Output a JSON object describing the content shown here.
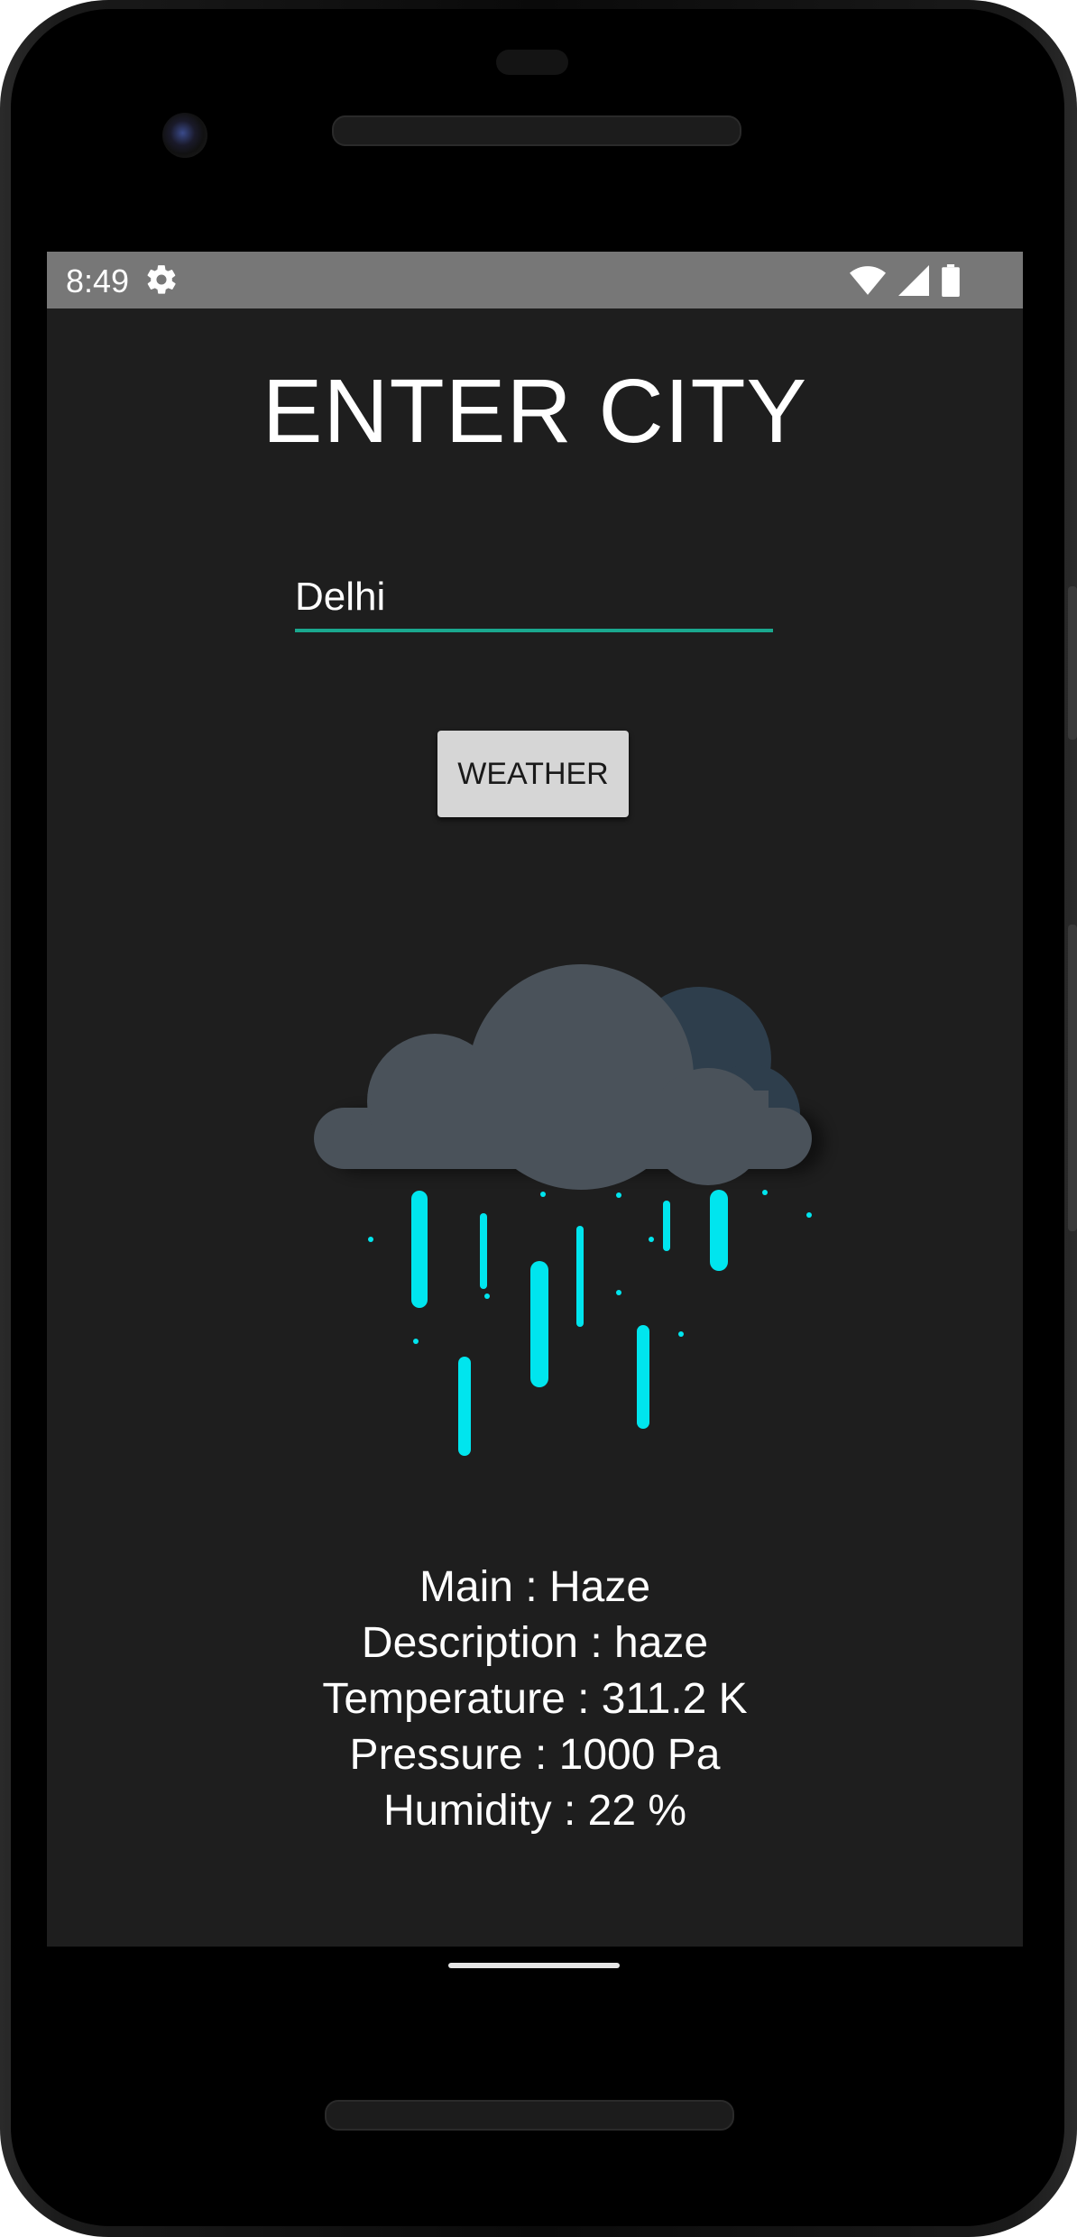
{
  "status_bar": {
    "time": "8:49",
    "icons": [
      "gear-icon",
      "wifi-icon",
      "cell-signal-icon",
      "battery-icon"
    ]
  },
  "app": {
    "title": "ENTER CITY",
    "city_input": {
      "value": "Delhi",
      "placeholder": ""
    },
    "weather_button_label": "WEATHER",
    "illustration": "rain-cloud-icon",
    "details": {
      "main": "Main : Haze",
      "description": "Description : haze",
      "temperature": "Temperature : 311.2 K",
      "pressure": "Pressure : 1000 Pa",
      "humidity": "Humidity : 22 %"
    }
  },
  "colors": {
    "screen_background": "#1e1e1e",
    "status_bar": "#777777",
    "input_underline": "#1aa88f",
    "button_background": "#d6d6d6",
    "rain": "#00e5ee",
    "cloud_front": "#4a525a",
    "cloud_back": "#2e3e4c"
  }
}
